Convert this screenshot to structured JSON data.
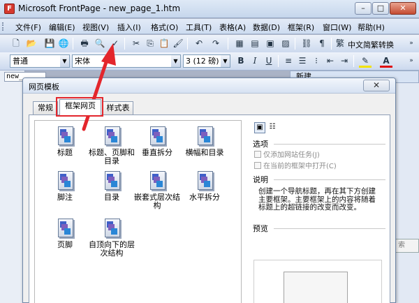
{
  "window": {
    "title": "Microsoft FrontPage - new_page_1.htm",
    "app_icon": "frontpage-icon",
    "buttons": {
      "minimize": "–",
      "restore": "□",
      "close": "✕"
    }
  },
  "menubar": {
    "items": [
      "文件(F)",
      "编辑(E)",
      "视图(V)",
      "插入(I)",
      "格式(O)",
      "工具(T)",
      "表格(A)",
      "数据(D)",
      "框架(R)",
      "窗口(W)",
      "帮助(H)"
    ]
  },
  "toolbar_standard": {
    "convert_label": "中文简繁转换"
  },
  "toolbar_format": {
    "style_value": "普通",
    "font_value": "宋体",
    "size_value": "3 (12 磅)",
    "bold": "B",
    "italic": "I",
    "underline": "U"
  },
  "background": {
    "doc_tab": "new_",
    "task_pane_title": "新建",
    "side_button": "索"
  },
  "dialog": {
    "title": "网页模板",
    "close": "✕",
    "tabs": [
      "常规",
      "框架网页",
      "样式表"
    ],
    "selected_tab": "框架网页",
    "templates": [
      "标题",
      "标题、页脚和目录",
      "垂直拆分",
      "横幅和目录",
      "脚注",
      "目录",
      "嵌套式层次结构",
      "水平拆分",
      "页脚",
      "自顶向下的层次结构"
    ],
    "options_label": "选项",
    "option_add_task": "仅添加网站任务(J)",
    "option_open_in_frame": "在当前的框架中打开(C)",
    "description_label": "说明",
    "description_text": "创建一个导航标题，再在其下方创建主要框架。主要框架上的内容将随着标题上的超链接的改变而改变。",
    "preview_label": "预览"
  },
  "colors": {
    "highlight": "#e3262c",
    "arrow": "#e3262c"
  }
}
